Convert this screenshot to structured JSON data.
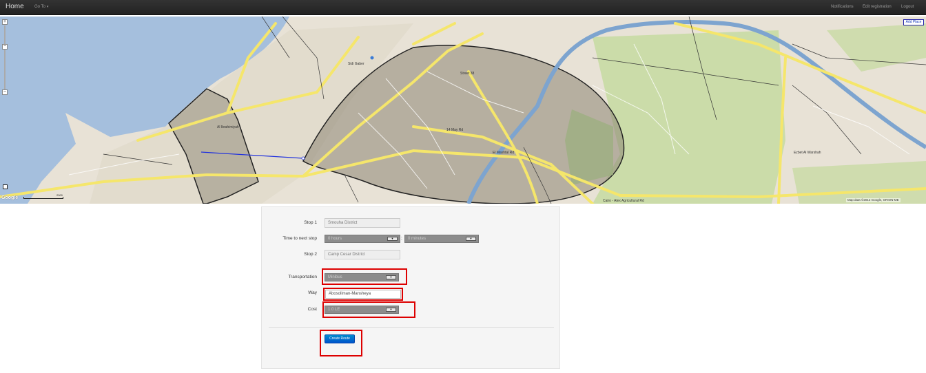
{
  "navbar": {
    "brand": "Home",
    "goto": "Go To",
    "right_links": [
      "Notifications",
      "Edit registration",
      "Logout"
    ]
  },
  "map": {
    "add_place": "Add Place",
    "copyright": "Map data ©2012 Google, ORION-ME",
    "google_logo": "Google",
    "scale": "2000",
    "labels": {
      "ibrahimiyah": "Al Ibrahimiyah",
      "street_38": "Street 38",
      "may_14": "14 May Rd",
      "el_mashtal": "El Mashtal Rd",
      "cairo_alex": "Cairo - Alex Agricultural Rd",
      "ezbet": "Ezbet Al Warshah",
      "sidi_gaber": "Sidi Gaber"
    },
    "colors": {
      "water": "#a5bfdd",
      "land": "#e8e2d6",
      "green": "#c8dba4",
      "road": "#f5e66b",
      "district": "#8c8575",
      "route": "#2233dd"
    }
  },
  "form": {
    "stop1_label": "Stop 1",
    "stop1_value": "Smouha District",
    "time_label": "Time to next stop",
    "hours_value": "0 hours",
    "minutes_value": "0 minutes",
    "stop2_label": "Stop 2",
    "stop2_value": "Camp Cesar District",
    "transportation_label": "Transportation",
    "transportation_value": "Minibus",
    "way_label": "Way",
    "way_value": "Abosoliman-Mansheya",
    "cost_label": "Cost",
    "cost_value": "1.0 LE",
    "submit_label": "Create Route"
  }
}
